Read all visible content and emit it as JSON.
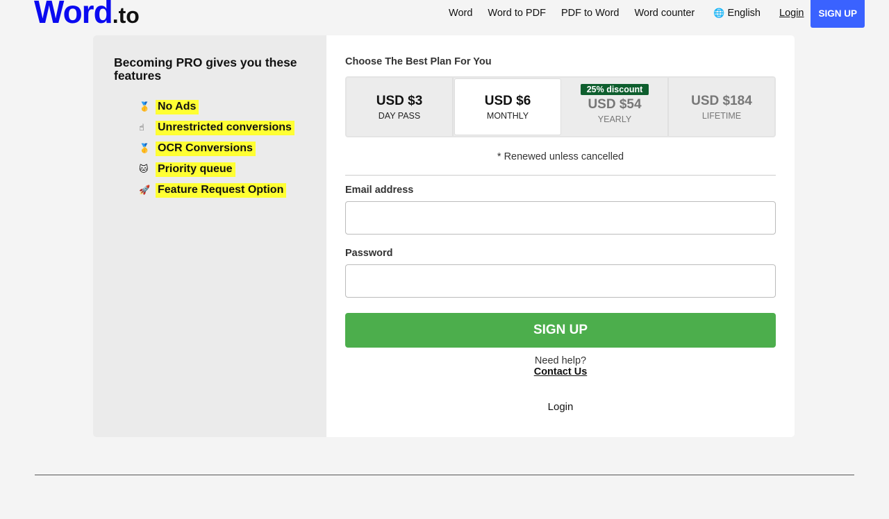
{
  "header": {
    "logo_main": "Word",
    "logo_tld": ".to",
    "nav": [
      {
        "label": "Word"
      },
      {
        "label": "Word to PDF"
      },
      {
        "label": "PDF to Word"
      },
      {
        "label": "Word counter"
      }
    ],
    "language": "English",
    "language_icon": "globe-icon",
    "login": "Login",
    "signup": "SIGN UP",
    "accent_color": "#3a62ff"
  },
  "features": {
    "title": "Becoming PRO gives you these features",
    "items": [
      {
        "icon": "medal-icon",
        "emoji": "🥇",
        "label": "No Ads"
      },
      {
        "icon": "pointing-finger-icon",
        "emoji": "☝",
        "label": "Unrestricted conversions"
      },
      {
        "icon": "medal-icon",
        "emoji": "🥇",
        "label": "OCR Conversions"
      },
      {
        "icon": "cat-icon",
        "emoji": "🐱",
        "label": "Priority queue"
      },
      {
        "icon": "rocket-icon",
        "emoji": "🚀",
        "label": "Feature Request Option"
      }
    ],
    "highlight_color": "#ffff33"
  },
  "plans": {
    "heading": "Choose The Best Plan For You",
    "options": [
      {
        "price": "USD $3",
        "period": "DAY PASS",
        "selected": false
      },
      {
        "price": "USD $6",
        "period": "MONTHLY",
        "selected": true
      },
      {
        "price": "USD $54",
        "period": "YEARLY",
        "badge": "25% discount",
        "selected": false
      },
      {
        "price": "USD $184",
        "period": "LIFETIME",
        "selected": false
      }
    ],
    "renew_note": "* Renewed unless cancelled",
    "badge_color": "#0e5e2e"
  },
  "form": {
    "email_label": "Email address",
    "email_value": "",
    "password_label": "Password",
    "password_value": "",
    "submit": "SIGN UP",
    "submit_color": "#4cae4c",
    "need_help": "Need help?",
    "contact": "Contact Us",
    "login": "Login"
  }
}
